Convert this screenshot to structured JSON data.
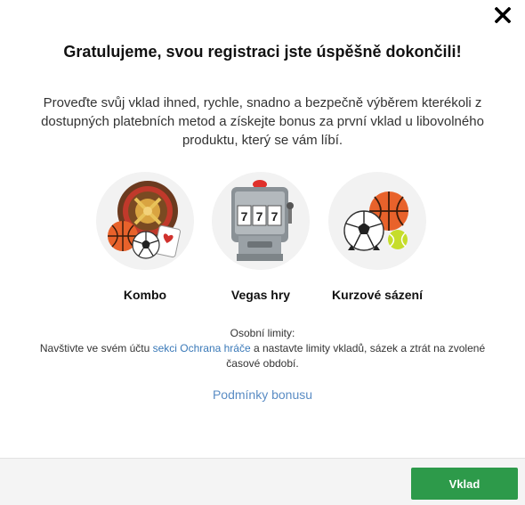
{
  "dialog": {
    "title": "Gratulujeme, svou registraci jste úspěšně dokončili!",
    "intro": "Proveďte svůj vklad ihned, rychle, snadno a bezpečně výběrem kterékoli z dostupných platebních metod a získejte bonus za první vklad u libovolného produktu, který se vám líbí."
  },
  "products": [
    {
      "label": "Kombo",
      "icon": "roulette-sports-icon"
    },
    {
      "label": "Vegas hry",
      "icon": "slot-machine-icon"
    },
    {
      "label": "Kurzové sázení",
      "icon": "sports-balls-icon"
    }
  ],
  "slot_reels": [
    "7",
    "7",
    "7"
  ],
  "limits": {
    "heading": "Osobní limity:",
    "text_before": "Navštivte ve svém účtu ",
    "link": "sekci Ochrana hráče",
    "text_after": " a nastavte limity vkladů, sázek a ztrát na zvolené časové období."
  },
  "bonus_link": "Podmínky bonusu",
  "footer": {
    "deposit_label": "Vklad"
  },
  "colors": {
    "accent_green": "#2d9a4a",
    "link_blue": "#3a79b8"
  }
}
